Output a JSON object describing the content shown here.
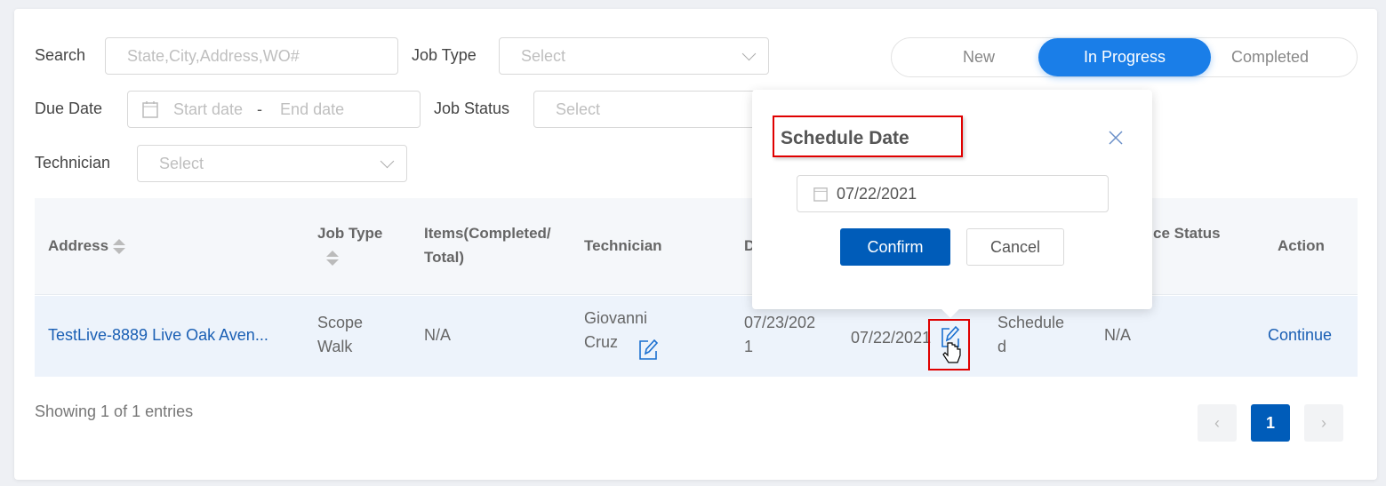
{
  "filters": {
    "search_label": "Search",
    "search_placeholder": "State,City,Address,WO#",
    "job_type_label": "Job Type",
    "job_type_placeholder": "Select",
    "due_date_label": "Due Date",
    "start_placeholder": "Start date",
    "range_separator": "-",
    "end_placeholder": "End date",
    "job_status_label": "Job Status",
    "job_status_placeholder": "Select",
    "technician_label": "Technician",
    "technician_placeholder": "Select"
  },
  "status_tabs": [
    {
      "label": "New",
      "active": false
    },
    {
      "label": "In Progress",
      "active": true
    },
    {
      "label": "Completed",
      "active": false
    }
  ],
  "table": {
    "headers": [
      "Address",
      "Job Type",
      "Items(Completed/Total)",
      "Technician",
      "D",
      "ce Status",
      "Action"
    ],
    "rows": [
      {
        "address": "TestLive-8889 Live Oak Aven...",
        "job_type": "Scope Walk",
        "items": "N/A",
        "technician": "Giovanni Cruz",
        "due_date": "07/23/2021",
        "schedule_date": "07/22/2021",
        "status": "Scheduled",
        "other_status": "N/A",
        "action": "Continue"
      }
    ]
  },
  "footer": {
    "showing": "Showing 1 of 1 entries",
    "page": "1"
  },
  "popup": {
    "title": "Schedule Date",
    "date_value": "07/22/2021",
    "confirm": "Confirm",
    "cancel": "Cancel"
  },
  "colors": {
    "primary": "#1a7ee8",
    "confirm": "#005cb9",
    "link": "#1a5fb4",
    "highlight": "#e00000"
  }
}
